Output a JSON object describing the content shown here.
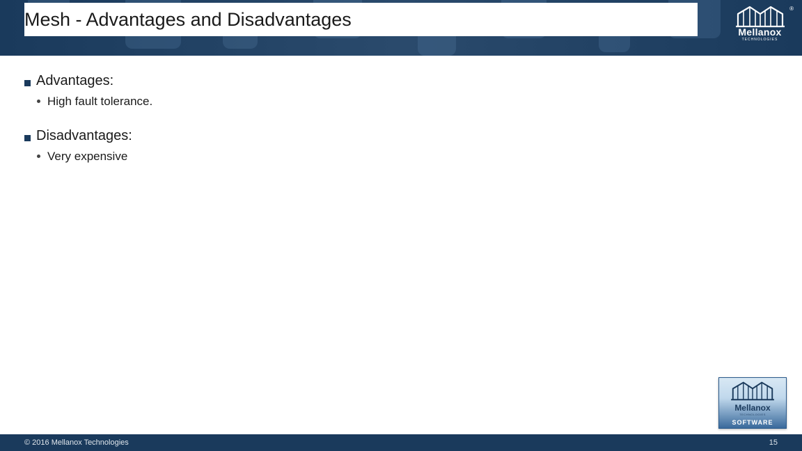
{
  "header": {
    "title": "Mesh - Advantages and Disadvantages",
    "logo": {
      "name": "Mellanox",
      "sub": "TECHNOLOGIES"
    }
  },
  "content": {
    "sections": [
      {
        "heading": "Advantages:",
        "items": [
          "High fault tolerance."
        ]
      },
      {
        "heading": "Disadvantages:",
        "items": [
          "Very expensive"
        ]
      }
    ]
  },
  "bottom_logo": {
    "name": "Mellanox",
    "sub": "TECHNOLOGIES",
    "software": "SOFTWARE"
  },
  "footer": {
    "copyright": "© 2016 Mellanox Technologies",
    "page": "15"
  }
}
